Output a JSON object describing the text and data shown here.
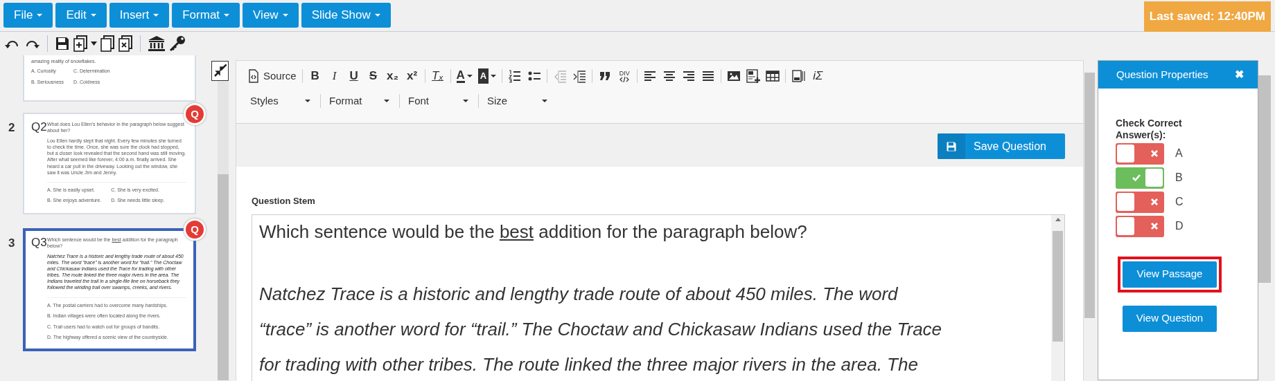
{
  "menu": [
    {
      "label": "File"
    },
    {
      "label": "Edit"
    },
    {
      "label": "Insert"
    },
    {
      "label": "Format"
    },
    {
      "label": "View"
    },
    {
      "label": "Slide Show"
    }
  ],
  "last_saved": "Last saved: 12:40PM",
  "slides": [
    {
      "selected": false,
      "passage": "amazing reality of snowflakes.",
      "passage_italic": false,
      "kind": "grid",
      "options": [
        "A. Curiosity",
        "B. Seriousness",
        "C. Determination",
        "D. Coldness"
      ]
    },
    {
      "number": "2",
      "label": "Q2",
      "badge": "Q",
      "selected": false,
      "question": [
        {
          "text": "What does Lou Ellen's behavior in the paragraph below suggest about her?",
          "underline": false
        }
      ],
      "passage": "Lou Ellen hardly slept that night. Every few minutes she turned to check the time. Once, she was sure the clock had stopped, but a closer look revealed that the second hand was still moving. After what seemed like forever, 4:00 a.m. finally arrived. She heard a car pull in the driveway. Looking out the window, she saw it was Uncle Jim and Jenny.",
      "passage_italic": false,
      "kind": "grid",
      "options": [
        "A. She is easily upset.",
        "B. She enjoys adventure.",
        "C. She is very excited.",
        "D. She needs little sleep."
      ]
    },
    {
      "number": "3",
      "label": "Q3",
      "badge": "Q",
      "selected": true,
      "question": [
        {
          "text": "Which sentence would be the ",
          "underline": false
        },
        {
          "text": "best",
          "underline": true
        },
        {
          "text": " addition for the paragraph below?",
          "underline": false
        }
      ],
      "passage": "Natchez Trace is a historic and lengthy trade route of about 450 miles. The word “trace” is another word for “trail.” The Choctaw and Chickasaw Indians used the Trace for trading with other tribes. The route linked the three major rivers in the area. The Indians traveled the trail in a single-file line on horseback they followed the winding trail over swamps, creeks, and rivers.",
      "passage_italic": true,
      "kind": "list",
      "options": [
        "A. The postal carriers had to overcome many hardships.",
        "B. Indian villages were often located along the rivers.",
        "C. Trail users had to watch out for groups of bandits.",
        "D. The highway offered a scenic view of the countryside."
      ]
    }
  ],
  "editor_toolbar": {
    "groups": [
      [
        {
          "kind": "source",
          "label": "Source",
          "disabled": false
        }
      ],
      [
        {
          "kind": "bold",
          "label": "B",
          "disabled": false
        },
        {
          "kind": "italic",
          "label": "I",
          "disabled": false
        },
        {
          "kind": "underline",
          "label": "U",
          "disabled": false
        },
        {
          "kind": "strike",
          "label": "S",
          "disabled": false
        },
        {
          "kind": "subscript",
          "label": "x₂",
          "disabled": false
        },
        {
          "kind": "superscript",
          "label": "x²",
          "disabled": false
        }
      ],
      [
        {
          "kind": "removeformat",
          "label": "Tₓ",
          "disabled": false
        }
      ],
      [
        {
          "kind": "textcolor",
          "label": "A",
          "disabled": false
        },
        {
          "kind": "bgcolor",
          "label": "A",
          "disabled": false
        }
      ],
      [
        {
          "kind": "numlist",
          "disabled": false
        },
        {
          "kind": "bullist",
          "disabled": false
        }
      ],
      [
        {
          "kind": "outdent",
          "disabled": true
        },
        {
          "kind": "indent",
          "disabled": false
        }
      ],
      [
        {
          "kind": "quote",
          "disabled": false
        },
        {
          "kind": "div",
          "label": "DIV",
          "disabled": false
        }
      ],
      [
        {
          "kind": "alignleft",
          "disabled": false
        },
        {
          "kind": "aligncenter",
          "disabled": false
        },
        {
          "kind": "alignright",
          "disabled": false
        },
        {
          "kind": "justify",
          "disabled": false
        }
      ],
      [
        {
          "kind": "image",
          "disabled": false
        },
        {
          "kind": "template",
          "disabled": false
        },
        {
          "kind": "table",
          "disabled": false
        }
      ],
      [
        {
          "kind": "iframe",
          "disabled": false
        },
        {
          "kind": "formula",
          "label": "iΣ",
          "disabled": false
        }
      ]
    ],
    "combos": [
      {
        "label": "Styles"
      },
      {
        "label": "Format"
      },
      {
        "label": "Font"
      },
      {
        "label": "Size"
      }
    ]
  },
  "save_button": "Save Question",
  "stem": {
    "heading": "Question Stem",
    "question": [
      {
        "text": "Which sentence would be the ",
        "underline": false
      },
      {
        "text": "best",
        "underline": true
      },
      {
        "text": " addition for the paragraph below?",
        "underline": false
      }
    ],
    "passage_lines": [
      "Natchez Trace is a historic and lengthy trade route of about 450 miles. The word",
      "“trace” is another word for “trail.” The Choctaw and Chickasaw Indians used the Trace",
      "for trading with other tribes. The route linked the three major rivers in the area. The"
    ]
  },
  "properties": {
    "title": "Question Properties",
    "close": "✖",
    "heading": "Check Correct Answer(s):",
    "answers": [
      {
        "letter": "A",
        "checked": false
      },
      {
        "letter": "B",
        "checked": true
      },
      {
        "letter": "C",
        "checked": false
      },
      {
        "letter": "D",
        "checked": false
      }
    ],
    "buttons": [
      {
        "label": "View Passage",
        "highlighted": true
      },
      {
        "label": "View Question",
        "highlighted": false
      }
    ]
  }
}
